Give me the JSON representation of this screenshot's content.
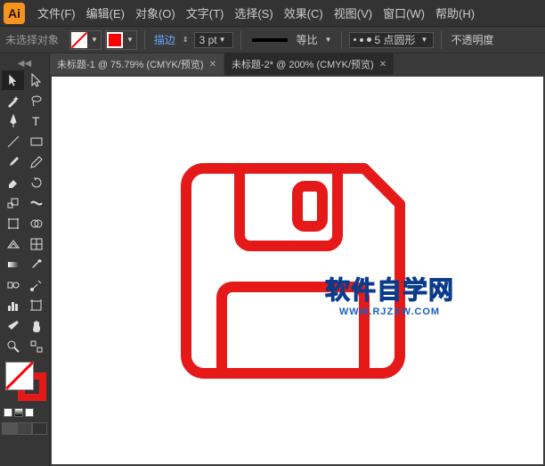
{
  "app": {
    "logo_text": "Ai"
  },
  "menu": {
    "items": [
      "文件(F)",
      "编辑(E)",
      "对象(O)",
      "文字(T)",
      "选择(S)",
      "效果(C)",
      "视图(V)",
      "窗口(W)",
      "帮助(H)"
    ]
  },
  "controlbar": {
    "no_selection": "未选择对象",
    "stroke_label": "描边",
    "stroke_pt": "3 pt",
    "uniform_label": "等比",
    "brush_label": "5 点圆形",
    "opacity_label": "不透明度"
  },
  "tabs": [
    {
      "label": "未标题-1 @ 75.79% (CMYK/预览)",
      "active": false
    },
    {
      "label": "未标题-2* @ 200% (CMYK/预览)",
      "active": true
    }
  ],
  "watermark": {
    "main": "软件自学网",
    "sub": "WWW.RJZXW.COM"
  },
  "colors": {
    "accent": "#e61919"
  }
}
